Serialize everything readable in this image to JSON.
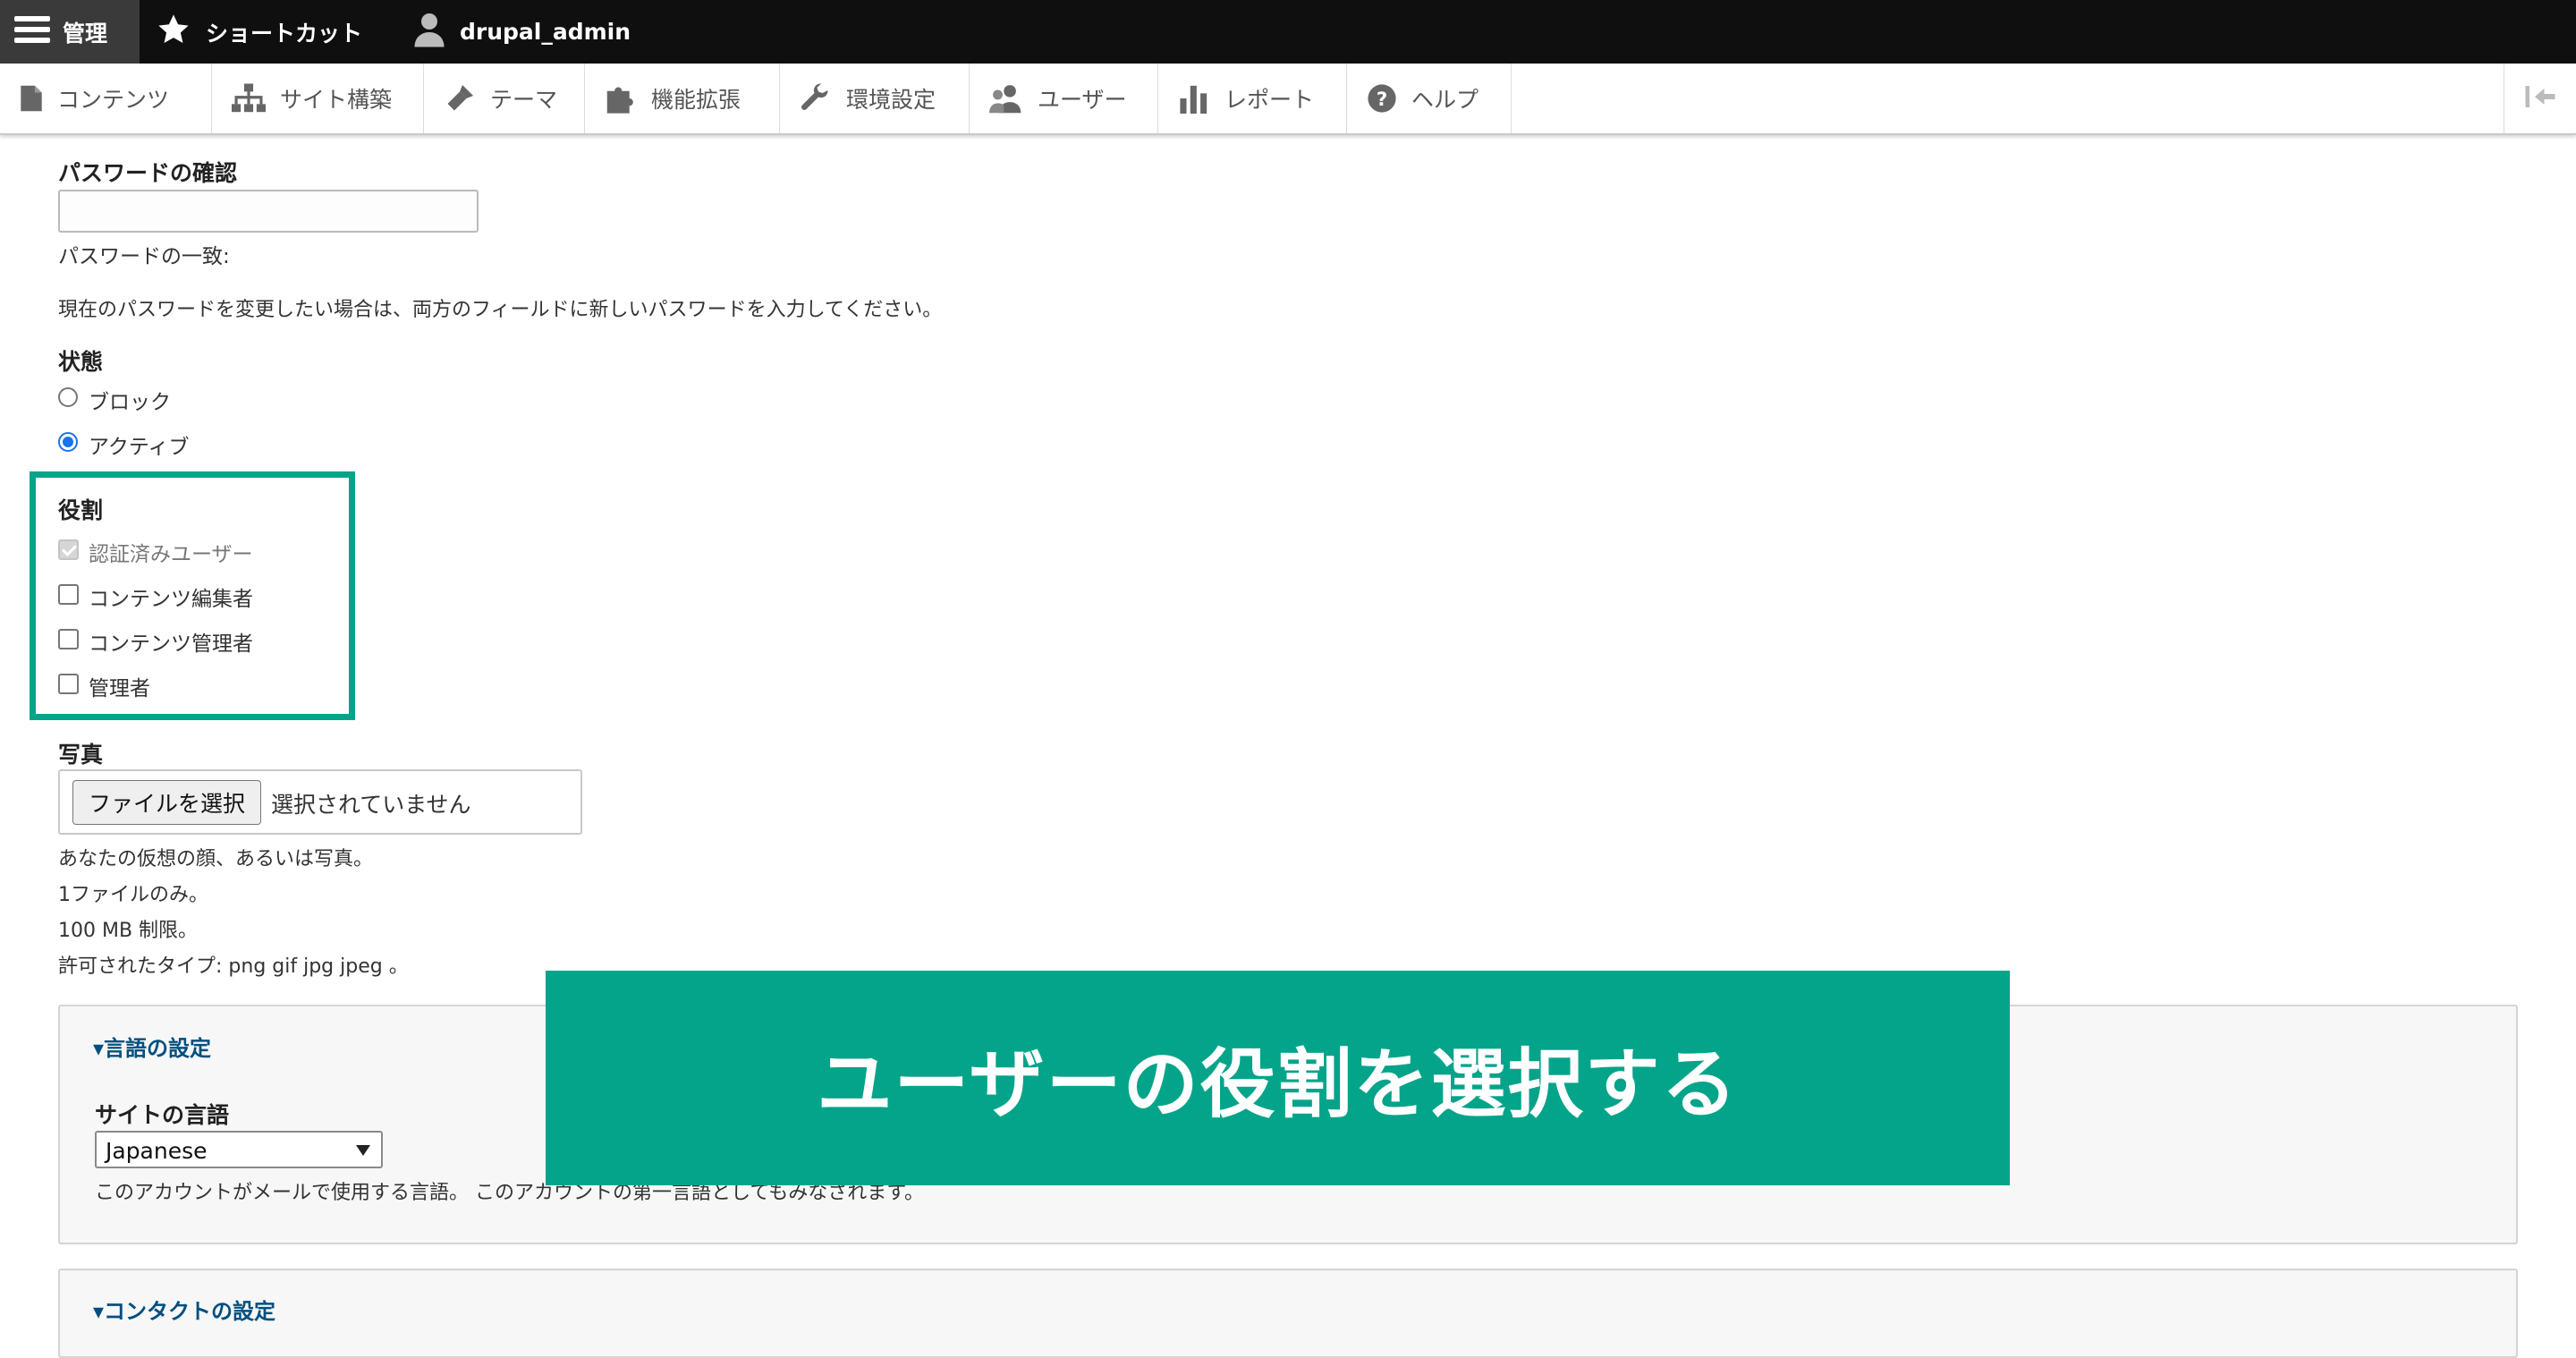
{
  "toolbar": {
    "manage": "管理",
    "shortcuts": "ショートカット",
    "user": "drupal_admin"
  },
  "tray": {
    "items": [
      "コンテンツ",
      "サイト構築",
      "テーマ",
      "機能拡張",
      "環境設定",
      "ユーザー",
      "レポート",
      "ヘルプ"
    ]
  },
  "form": {
    "password_confirm_label": "パスワードの確認",
    "password_match": "パスワードの一致:",
    "password_help": "現在のパスワードを変更したい場合は、両方のフィールドに新しいパスワードを入力してください。",
    "status_label": "状態",
    "status_options": [
      "ブロック",
      "アクティブ"
    ],
    "status_selected": "アクティブ",
    "roles_label": "役割",
    "roles": [
      "認証済みユーザー",
      "コンテンツ編集者",
      "コンテンツ管理者",
      "管理者"
    ],
    "photo_label": "写真",
    "file_button": "ファイルを選択",
    "file_status": "選択されていません",
    "photo_help": [
      "あなたの仮想の顔、あるいは写真。",
      "1ファイルのみ。",
      "100 MB 制限。",
      "許可されたタイプ: png gif jpg jpeg 。"
    ]
  },
  "language": {
    "summary": "▾言語の設定",
    "site_language_label": "サイトの言語",
    "site_language_value": "Japanese",
    "help": "このアカウントがメールで使用する言語。 このアカウントの第一言語としてもみなされます。"
  },
  "contact": {
    "summary": "▾コンタクトの設定"
  },
  "banner": {
    "text": "ユーザーの役割を選択する"
  },
  "colors": {
    "highlight": "#04a48a",
    "link": "#004f80",
    "toolbar": "#0f0f0f"
  }
}
